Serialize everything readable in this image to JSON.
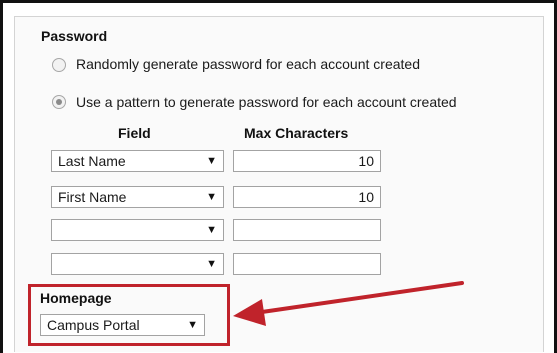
{
  "password": {
    "heading": "Password",
    "options": [
      {
        "label": "Randomly generate password for each account created",
        "selected": false
      },
      {
        "label": "Use a pattern to generate password for each account created",
        "selected": true
      }
    ],
    "columns": {
      "field": "Field",
      "max_chars": "Max Characters"
    },
    "rows": [
      {
        "field": "Last Name",
        "max": "10"
      },
      {
        "field": "First Name",
        "max": "10"
      },
      {
        "field": "",
        "max": ""
      },
      {
        "field": "",
        "max": ""
      }
    ]
  },
  "homepage": {
    "heading": "Homepage",
    "value": "Campus Portal"
  },
  "icons": {
    "dropdown_arrow": "▼",
    "annotation_arrow": "red-arrow-icon"
  },
  "colors": {
    "highlight": "#c0232b"
  }
}
